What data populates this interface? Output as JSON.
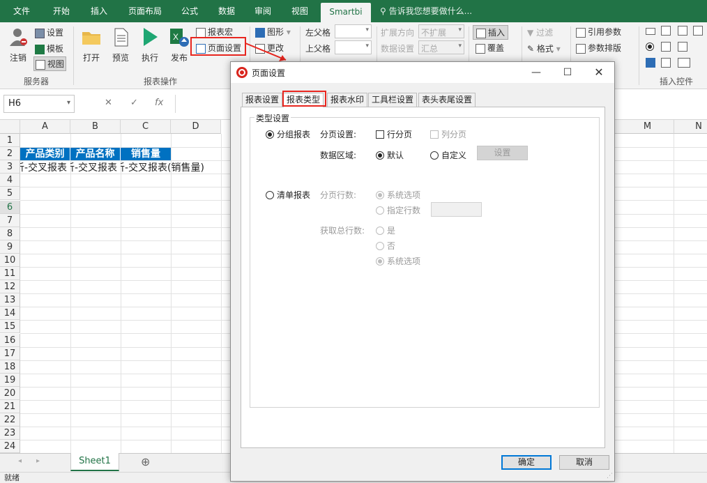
{
  "ribbon_tabs": [
    "文件",
    "开始",
    "插入",
    "页面布局",
    "公式",
    "数据",
    "审阅",
    "视图",
    "Smartbi"
  ],
  "active_tab": "Smartbi",
  "tellme": "告诉我您想要做什么...",
  "ribbon": {
    "logout": "注销",
    "settings": "设置",
    "template": "模板",
    "view": "视图",
    "group_server": "服务器",
    "open": "打开",
    "preview": "预览",
    "run": "执行",
    "publish": "发布",
    "report_macro": "报表宏",
    "page_setup": "页面设置",
    "group_report_ops": "报表操作",
    "chart": "图形",
    "change": "更改",
    "left_parent": "左父格",
    "top_parent": "上父格",
    "expand_dir": "扩展方向",
    "expand_dir_val": "不扩展",
    "data_setting": "数据设置",
    "data_setting_val": "汇总",
    "insert": "插入",
    "overwrite": "覆盖",
    "filter": "过滤",
    "format": "格式",
    "ref_param": "引用参数",
    "param_layout": "参数排版",
    "group_insert_ctrl": "插入控件"
  },
  "formula": {
    "name_box": "H6",
    "cancel": "✕",
    "enter": "✓",
    "fx": "fx"
  },
  "columns": [
    "A",
    "B",
    "C",
    "D",
    "M",
    "N"
  ],
  "rows": [
    "1",
    "2",
    "3",
    "4",
    "5",
    "6",
    "7",
    "8",
    "9",
    "10",
    "11",
    "12",
    "13",
    "14",
    "15",
    "16",
    "17",
    "18",
    "19",
    "20",
    "21",
    "22",
    "23",
    "24"
  ],
  "cells": {
    "a2": "产品类别",
    "b2": "产品名称",
    "c2": "销售量",
    "a3": "析-交叉报表",
    "b3": "析-交叉报表",
    "c3": "析-交叉报表(销售量)"
  },
  "sheet_tab": "Sheet1",
  "add_sheet": "⊕",
  "status": "就绪",
  "dialog": {
    "title": "页面设置",
    "tabs": [
      "报表设置",
      "报表类型",
      "报表水印",
      "工具栏设置",
      "表头表尾设置"
    ],
    "active_tab": "报表类型",
    "legend": "类型设置",
    "group_report": "分组报表",
    "paging_setting": "分页设置:",
    "row_paging": "行分页",
    "col_paging": "列分页",
    "data_area": "数据区域:",
    "default": "默认",
    "custom": "自定义",
    "set_button": "设置",
    "list_report": "清单报表",
    "page_rows": "分页行数:",
    "system_option": "系统选项",
    "specify_rows": "指定行数",
    "get_total_rows": "获取总行数:",
    "yes": "是",
    "no": "否",
    "system_option2": "系统选项",
    "ok": "确定",
    "cancel": "取消"
  },
  "colors": {
    "excel_green": "#217346",
    "header_blue": "#0071c1",
    "highlight_red": "#e8261f"
  }
}
